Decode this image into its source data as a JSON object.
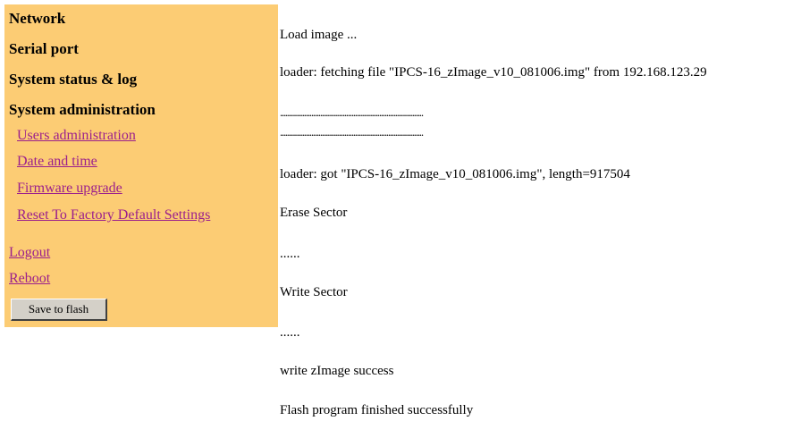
{
  "sidebar": {
    "sections": {
      "network": "Network",
      "serial_port": "Serial port",
      "system_status": "System status & log",
      "system_admin": "System administration"
    },
    "admin_links": {
      "users": "Users administration",
      "date_time": "Date and time",
      "firmware": "Firmware upgrade",
      "reset": "Reset To Factory Default Settings"
    },
    "logout": "Logout",
    "reboot": "Reboot",
    "save_button": "Save to flash"
  },
  "log": {
    "lines": [
      "Load image ...",
      "loader: fetching file \"IPCS-16_zImage_v10_081006.img\" from 192.168.123.29",
      "..............................................................................",
      "..............................................................................",
      "loader: got \"IPCS-16_zImage_v10_081006.img\", length=917504",
      "Erase Sector",
      "......",
      "Write Sector",
      "......",
      "write zImage success",
      "Flash program finished successfully"
    ]
  },
  "colors": {
    "sidebar_bg": "#fccc74",
    "link": "#9b1f8c"
  }
}
